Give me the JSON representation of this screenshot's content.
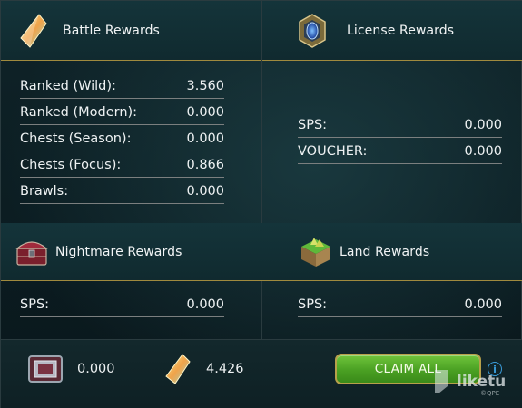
{
  "battle": {
    "title": "Battle Rewards",
    "icon": "shard-icon",
    "rows": [
      {
        "label": "Ranked (Wild):",
        "value": "3.560"
      },
      {
        "label": "Ranked (Modern):",
        "value": "0.000"
      },
      {
        "label": "Chests (Season):",
        "value": "0.000"
      },
      {
        "label": "Chests (Focus):",
        "value": "0.866"
      },
      {
        "label": "Brawls:",
        "value": "0.000"
      }
    ]
  },
  "license": {
    "title": "License Rewards",
    "icon": "license-emblem-icon",
    "rows": [
      {
        "label": "SPS:",
        "value": "0.000"
      },
      {
        "label": "VOUCHER:",
        "value": "0.000"
      }
    ]
  },
  "nightmare": {
    "title": "Nightmare Rewards",
    "icon": "chest-icon",
    "rows": [
      {
        "label": "SPS:",
        "value": "0.000"
      }
    ]
  },
  "land": {
    "title": "Land Rewards",
    "icon": "land-icon",
    "rows": [
      {
        "label": "SPS:",
        "value": "0.000"
      }
    ]
  },
  "footer": {
    "dec_value": "0.000",
    "shard_value": "4.426",
    "claim_label": "CLAIM ALL",
    "info_label": "i"
  },
  "watermark": {
    "text": "liketu",
    "sub": "©QPE"
  },
  "colors": {
    "divider": "#a08a3e",
    "button": "#4aa023",
    "button_border": "#b7a04a",
    "info": "#3a9bd8"
  }
}
